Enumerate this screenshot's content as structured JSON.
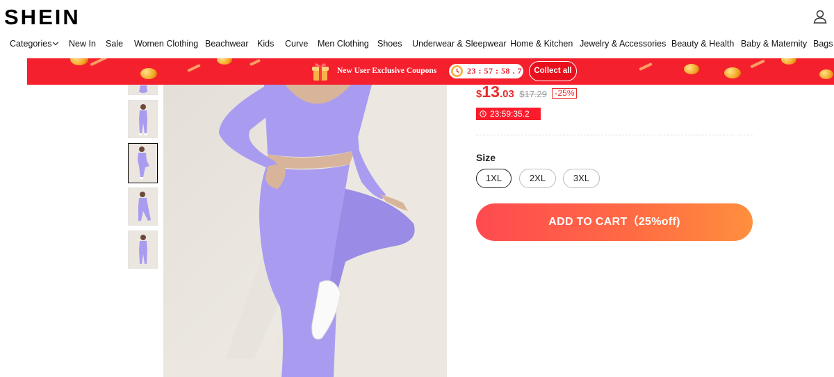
{
  "header": {
    "logo": "SHEIN",
    "user_icon": "user-icon"
  },
  "nav": {
    "items": [
      "Categories",
      "New In",
      "Sale",
      "Women Clothing",
      "Beachwear",
      "Kids",
      "Curve",
      "Men Clothing",
      "Shoes",
      "Underwear & Sleepwear",
      "Home & Kitchen",
      "Jewelry & Accessories",
      "Beauty & Health",
      "Baby & Maternity",
      "Bags"
    ]
  },
  "promo": {
    "text": "New User Exclusive Coupons",
    "timer": "23 : 57 : 58 . 7",
    "button": "Collect all",
    "bg_color": "#f5202e"
  },
  "product": {
    "price_symbol": "$",
    "price_int": "13",
    "price_dec": ".03",
    "original_price": "$17.29",
    "discount": "-25%",
    "countdown": "23:59:35.2",
    "accent_color": "#e82c2c"
  },
  "size": {
    "label": "Size",
    "options": [
      "1XL",
      "2XL",
      "3XL"
    ],
    "selected": "1XL"
  },
  "cart": {
    "label": "ADD TO CART（25%off)"
  },
  "product_color": "#a99cf0"
}
